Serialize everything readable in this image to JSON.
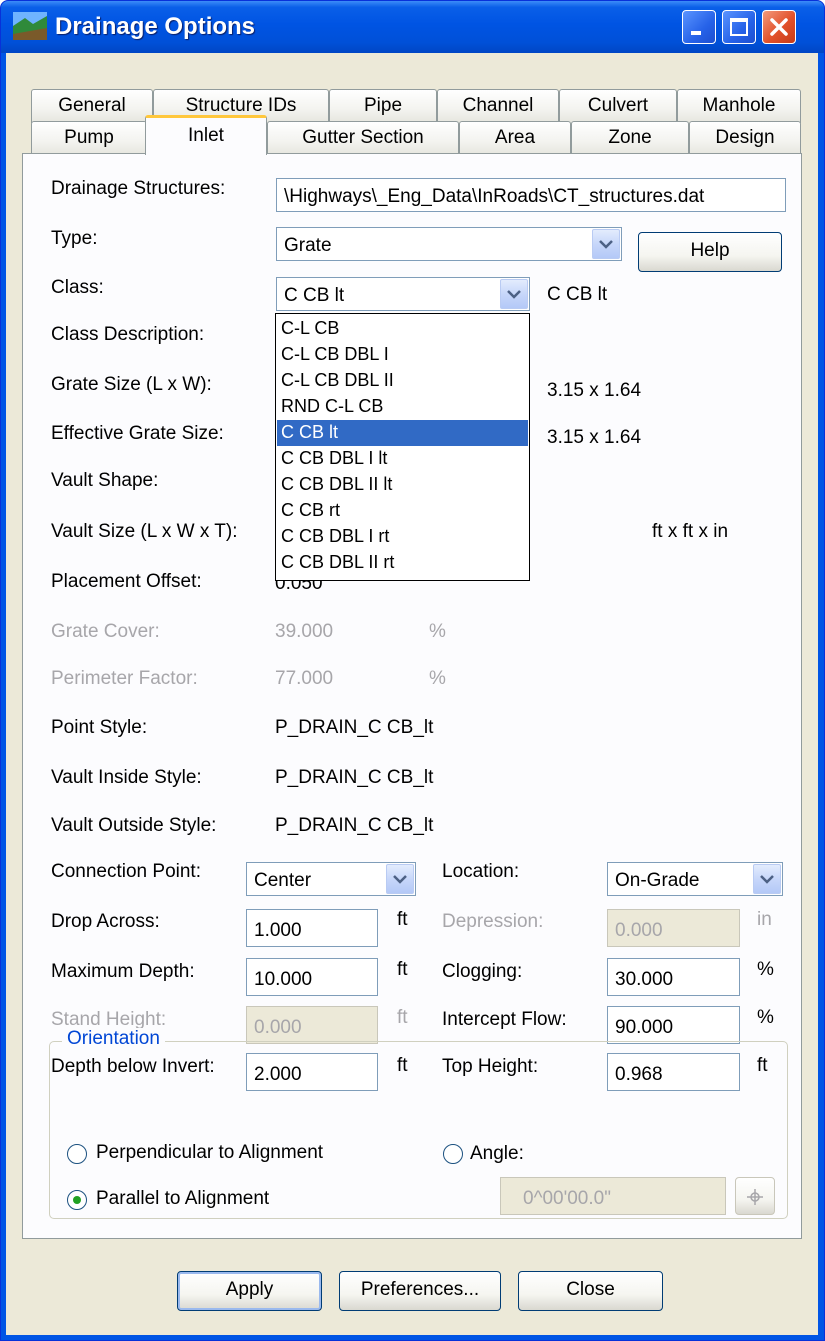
{
  "window": {
    "title": "Drainage Options",
    "icon": "drainage-app-icon"
  },
  "tabs_row1": [
    "General",
    "Structure IDs",
    "Pipe",
    "Channel",
    "Culvert",
    "Manhole"
  ],
  "tabs_row2": [
    "Pump",
    "Inlet",
    "Gutter Section",
    "Area",
    "Zone",
    "Design"
  ],
  "active_tab": "Inlet",
  "form": {
    "drainage_structures_label": "Drainage Structures:",
    "drainage_structures_value": "\\Highways\\_Eng_Data\\InRoads\\CT_structures.dat",
    "type_label": "Type:",
    "type_value": "Grate",
    "help_label": "Help",
    "class_label": "Class:",
    "class_value": "C CB lt",
    "class_display": "C CB lt",
    "class_description_label": "Class Description:",
    "grate_size_label": "Grate Size (L x W):",
    "grate_size_value": "3.15 x 1.64",
    "effective_grate_size_label": "Effective Grate Size:",
    "effective_grate_size_value": "3.15 x 1.64",
    "vault_shape_label": "Vault Shape:",
    "vault_size_label": "Vault Size (L x W x T):",
    "vault_size_units": "ft x ft x in",
    "placement_offset_label": "Placement Offset:",
    "placement_offset_value": "0.050",
    "grate_cover_label": "Grate Cover:",
    "grate_cover_value": "39.000",
    "grate_cover_unit": "%",
    "perimeter_factor_label": "Perimeter Factor:",
    "perimeter_factor_value": "77.000",
    "perimeter_factor_unit": "%",
    "point_style_label": "Point Style:",
    "point_style_value": "P_DRAIN_C CB_lt",
    "vault_inside_style_label": "Vault Inside Style:",
    "vault_inside_style_value": "P_DRAIN_C CB_lt",
    "vault_outside_style_label": "Vault Outside Style:",
    "vault_outside_style_value": "P_DRAIN_C CB_lt",
    "connection_point_label": "Connection Point:",
    "connection_point_value": "Center",
    "location_label": "Location:",
    "location_value": "On-Grade",
    "drop_across_label": "Drop Across:",
    "drop_across_value": "1.000",
    "drop_across_unit": "ft",
    "depression_label": "Depression:",
    "depression_value": "0.000",
    "depression_unit": "in",
    "maximum_depth_label": "Maximum Depth:",
    "maximum_depth_value": "10.000",
    "maximum_depth_unit": "ft",
    "clogging_label": "Clogging:",
    "clogging_value": "30.000",
    "clogging_unit": "%",
    "stand_height_label": "Stand Height:",
    "stand_height_value": "0.000",
    "stand_height_unit": "ft",
    "intercept_flow_label": "Intercept Flow:",
    "intercept_flow_value": "90.000",
    "intercept_flow_unit": "%",
    "depth_below_invert_label": "Depth below Invert:",
    "depth_below_invert_value": "2.000",
    "depth_below_invert_unit": "ft",
    "top_height_label": "Top Height:",
    "top_height_value": "0.968",
    "top_height_unit": "ft"
  },
  "class_options": [
    "C-L CB",
    "C-L CB DBL I",
    "C-L CB DBL II",
    "RND C-L CB",
    "C CB lt",
    "C CB DBL I lt",
    "C CB DBL II lt",
    "C CB rt",
    "C CB DBL I rt",
    "C CB DBL II rt"
  ],
  "class_selected": "C CB lt",
  "orientation": {
    "title": "Orientation",
    "perpendicular_label": "Perpendicular to  Alignment",
    "angle_label": "Angle:",
    "parallel_label": "Parallel to Alignment",
    "angle_value": "0^00'00.0\"",
    "selected": "Parallel to Alignment"
  },
  "buttons": {
    "apply": "Apply",
    "preferences": "Preferences...",
    "close": "Close"
  },
  "colors": {
    "title_bar": "#0054e3",
    "selection": "#316ac5",
    "active_tab_accent": "#ffc73c",
    "group_title": "#0046d5",
    "disabled_text": "#a7a6aa"
  }
}
